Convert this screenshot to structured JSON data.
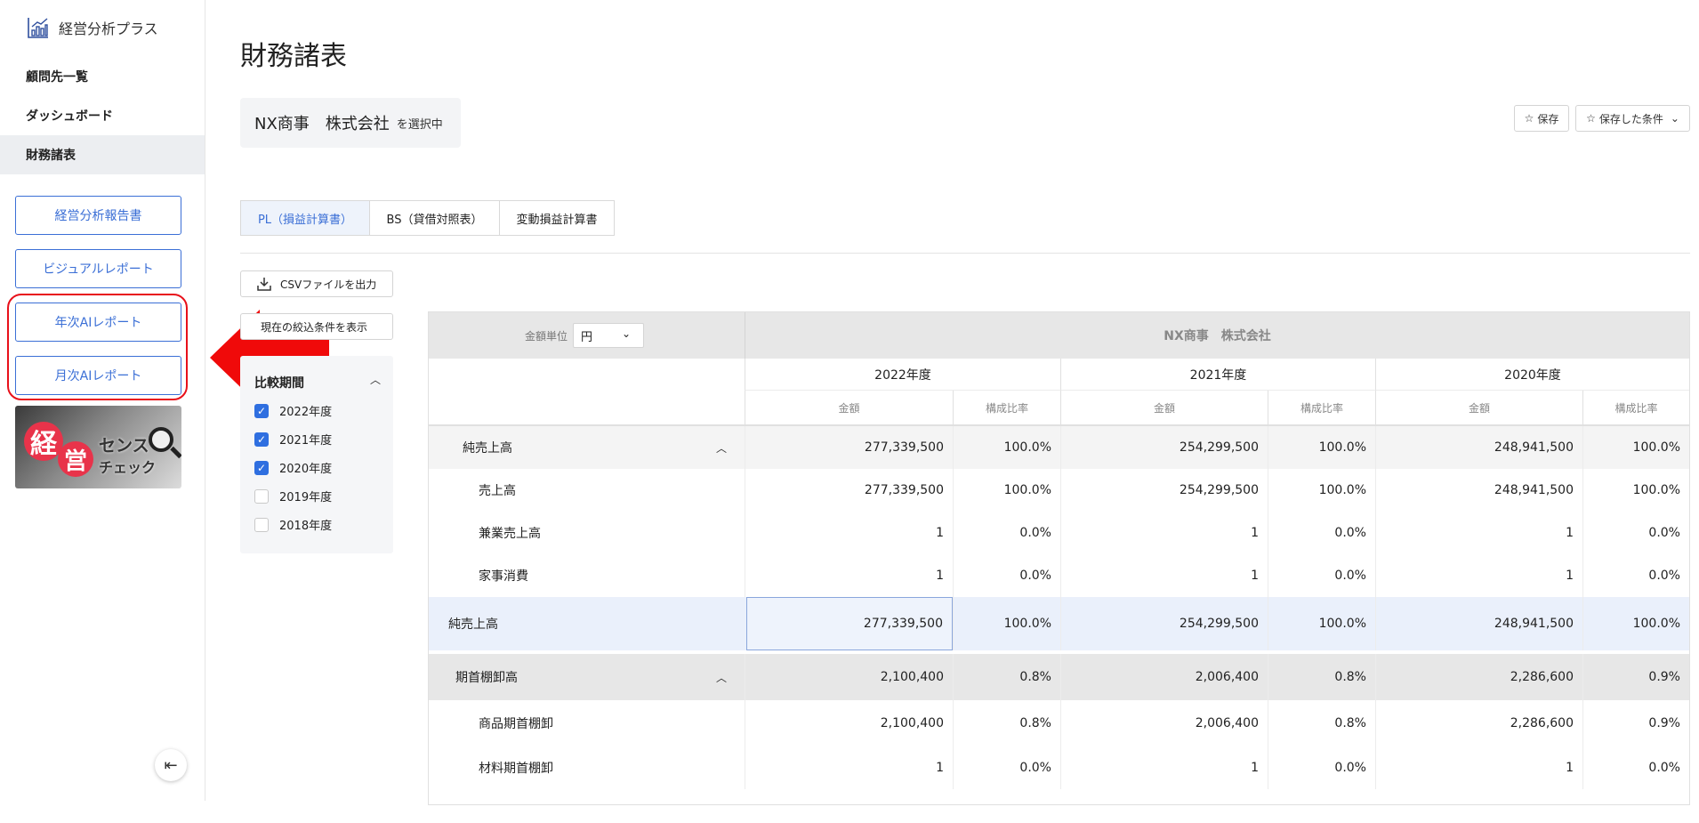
{
  "app": {
    "title": "経営分析プラス"
  },
  "sidebar": {
    "nav": [
      {
        "label": "顧問先一覧"
      },
      {
        "label": "ダッシュボード"
      },
      {
        "label": "財務諸表"
      }
    ],
    "buttons": [
      {
        "label": "経営分析報告書"
      },
      {
        "label": "ビジュアルレポート"
      },
      {
        "label": "年次AIレポート"
      },
      {
        "label": "月次AIレポート"
      }
    ],
    "banner": {
      "kei": "経",
      "ei": "営",
      "sense": "センス",
      "check": "チェック"
    },
    "collapse_icon": "collapse-left-icon"
  },
  "main": {
    "title": "財務諸表",
    "company": {
      "name": "NX商事　株式会社",
      "selected_suffix": "を選択中"
    },
    "save_label": "保存",
    "saved_conditions_label": "保存した条件",
    "tabs": [
      {
        "label": "PL（損益計算書）",
        "active": true
      },
      {
        "label": "BS（貸借対照表）",
        "active": false
      },
      {
        "label": "変動損益計算書",
        "active": false
      }
    ],
    "csv_label": "CSVファイルを出力",
    "filter_label": "現在の絞込条件を表示",
    "period": {
      "title": "比較期間",
      "options": [
        {
          "label": "2022年度",
          "checked": true
        },
        {
          "label": "2021年度",
          "checked": true
        },
        {
          "label": "2020年度",
          "checked": true
        },
        {
          "label": "2019年度",
          "checked": false
        },
        {
          "label": "2018年度",
          "checked": false
        }
      ]
    }
  },
  "table": {
    "unit_label": "金額単位",
    "unit_value": "円",
    "company": "NX商事　株式会社",
    "years": [
      "2022年度",
      "2021年度",
      "2020年度"
    ],
    "sub_amount": "金額",
    "sub_ratio": "構成比率",
    "rows": [
      {
        "label": "純売上高",
        "values": [
          "277,339,500",
          "100.0%",
          "254,299,500",
          "100.0%",
          "248,941,500",
          "100.0%"
        ]
      },
      {
        "label": "売上高",
        "values": [
          "277,339,500",
          "100.0%",
          "254,299,500",
          "100.0%",
          "248,941,500",
          "100.0%"
        ]
      },
      {
        "label": "兼業売上高",
        "values": [
          "1",
          "0.0%",
          "1",
          "0.0%",
          "1",
          "0.0%"
        ]
      },
      {
        "label": "家事消費",
        "values": [
          "1",
          "0.0%",
          "1",
          "0.0%",
          "1",
          "0.0%"
        ]
      },
      {
        "label": "純売上高",
        "values": [
          "277,339,500",
          "100.0%",
          "254,299,500",
          "100.0%",
          "248,941,500",
          "100.0%"
        ]
      },
      {
        "label": "期首棚卸高",
        "values": [
          "2,100,400",
          "0.8%",
          "2,006,400",
          "0.8%",
          "2,286,600",
          "0.9%"
        ]
      },
      {
        "label": "商品期首棚卸",
        "values": [
          "2,100,400",
          "0.8%",
          "2,006,400",
          "0.8%",
          "2,286,600",
          "0.9%"
        ]
      },
      {
        "label": "材料期首棚卸",
        "values": [
          "1",
          "0.0%",
          "1",
          "0.0%",
          "1",
          "0.0%"
        ]
      }
    ]
  },
  "colors": {
    "accent": "#3b6fd6",
    "annotation_red": "#e8101a",
    "checkbox": "#2f6fe0"
  }
}
